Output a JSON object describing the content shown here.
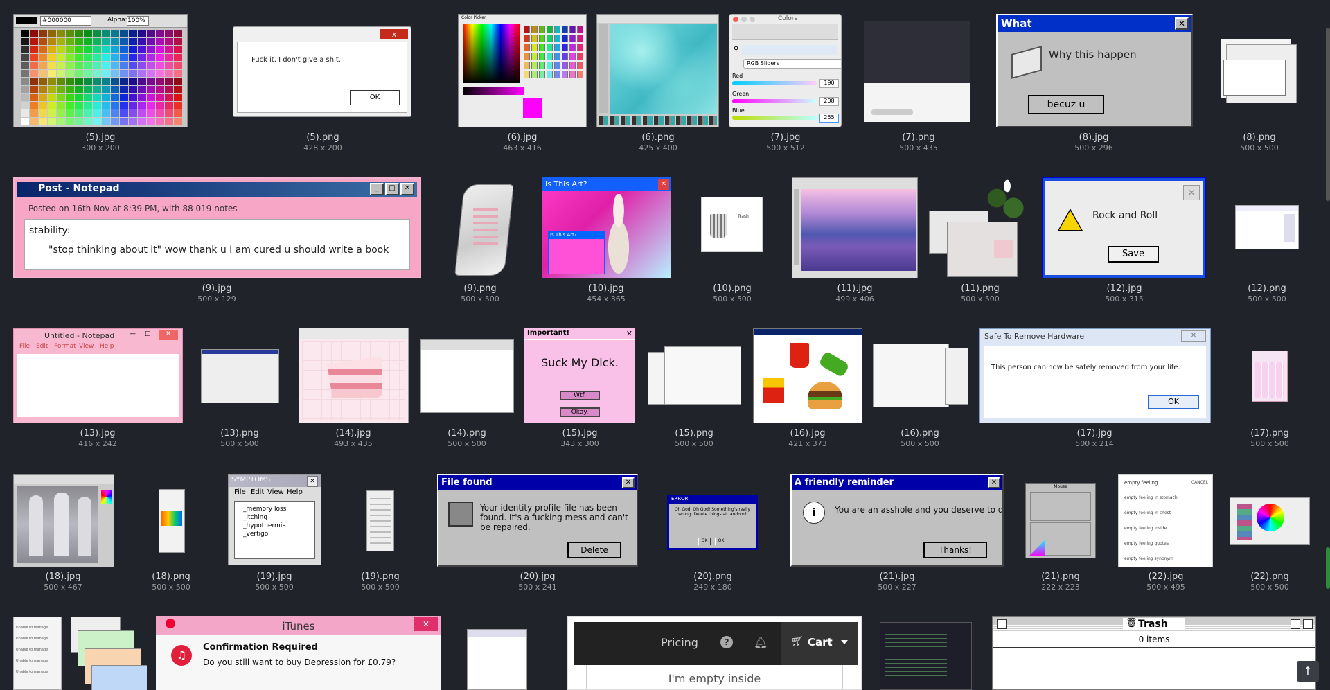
{
  "items": [
    {
      "name": "(5).jpg",
      "size": "300 x 200"
    },
    {
      "name": "(5).png",
      "size": "428 x 200"
    },
    {
      "name": "(6).jpg",
      "size": "463 x 416"
    },
    {
      "name": "(6).png",
      "size": "425 x 400"
    },
    {
      "name": "(7).jpg",
      "size": "500 x 512"
    },
    {
      "name": "(7).png",
      "size": "500 x 435"
    },
    {
      "name": "(8).jpg",
      "size": "500 x 296"
    },
    {
      "name": "(8).png",
      "size": "500 x 500"
    },
    {
      "name": "(9).jpg",
      "size": "500 x 129"
    },
    {
      "name": "(9).png",
      "size": "500 x 500"
    },
    {
      "name": "(10).jpg",
      "size": "454 x 365"
    },
    {
      "name": "(10).png",
      "size": "500 x 500"
    },
    {
      "name": "(11).jpg",
      "size": "499 x 406"
    },
    {
      "name": "(11).png",
      "size": "500 x 500"
    },
    {
      "name": "(12).jpg",
      "size": "500 x 315"
    },
    {
      "name": "(12).png",
      "size": "500 x 500"
    },
    {
      "name": "(13).jpg",
      "size": "416 x 242"
    },
    {
      "name": "(13).png",
      "size": "500 x 500"
    },
    {
      "name": "(14).jpg",
      "size": "493 x 435"
    },
    {
      "name": "(14).png",
      "size": "500 x 500"
    },
    {
      "name": "(15).jpg",
      "size": "343 x 300"
    },
    {
      "name": "(15).png",
      "size": "500 x 500"
    },
    {
      "name": "(16).jpg",
      "size": "421 x 373"
    },
    {
      "name": "(16).png",
      "size": "500 x 500"
    },
    {
      "name": "(17).jpg",
      "size": "500 x 214"
    },
    {
      "name": "(17).png",
      "size": "500 x 500"
    },
    {
      "name": "(18).jpg",
      "size": "500 x 467"
    },
    {
      "name": "(18).png",
      "size": "500 x 500"
    },
    {
      "name": "(19).jpg",
      "size": "500 x 500"
    },
    {
      "name": "(19).png",
      "size": "500 x 500"
    },
    {
      "name": "(20).jpg",
      "size": "500 x 241"
    },
    {
      "name": "(20).png",
      "size": "249 x 180"
    },
    {
      "name": "(21).jpg",
      "size": "500 x 227"
    },
    {
      "name": "(21).png",
      "size": "222 x 223"
    },
    {
      "name": "(22).jpg",
      "size": "500 x 495"
    },
    {
      "name": "(22).png",
      "size": "500 x 500"
    }
  ],
  "thumbs": {
    "t5jpg": {
      "hex": "#000000",
      "alpha_label": "Alpha:",
      "alpha_value": "100%"
    },
    "t5png": {
      "message": "Fuck it. I don't give a shit.",
      "ok": "OK"
    },
    "t6jpg": {
      "title": "Color Picker"
    },
    "t7jpg": {
      "title": "Colors",
      "mode": "RGB Sliders",
      "red_label": "Red",
      "red_value": "190",
      "green_label": "Green",
      "green_value": "208",
      "blue_label": "Blue",
      "blue_value": "255"
    },
    "t8jpg": {
      "title": "What",
      "message": "Why this happen",
      "button": "becuz u"
    },
    "t9jpg": {
      "title": "Post - Notepad",
      "posted": "Posted on 16th Nov at 8:39 PM, with 88 019 notes",
      "line1": "stability:",
      "line2": "\"stop thinking about it\" wow thank u I am cured u should write a book"
    },
    "t10jpg": {
      "title": "Is This Art?",
      "inner_title": "Is This Art?"
    },
    "t10png": {
      "title": "Trash"
    },
    "t12jpg": {
      "message": "Rock and Roll",
      "button": "Save"
    },
    "t13jpg": {
      "title": "Untitled - Notepad",
      "menu": [
        "File",
        "Edit",
        "Format",
        "View",
        "Help"
      ]
    },
    "t15jpg": {
      "title": "Important!",
      "message": "Suck My Dick.",
      "btn1": "Wtf.",
      "btn2": "Okay."
    },
    "t17jpg": {
      "title": "Safe To Remove Hardware",
      "message": "This person can now be safely removed from your life.",
      "ok": "OK"
    },
    "t19jpg": {
      "title": "SYMPTOMS",
      "menu": [
        "File",
        "Edit",
        "View",
        "Help"
      ],
      "lines": [
        "_memory loss",
        "_itching",
        "_hypothermia",
        "_vertigo"
      ]
    },
    "t20jpg": {
      "title": "File found",
      "message": "Your identity profile file has been found. It's a fucking mess and can't be repaired.",
      "button": "Delete"
    },
    "t20png": {
      "title": "ERROR",
      "message": "Oh God. Oh God! Something's really wrong. Delete things at random?",
      "ok1": "OK",
      "ok2": "OK"
    },
    "t21jpg": {
      "title": "A friendly reminder",
      "message": "You are an asshole and you deserve to die.",
      "button": "Thanks!"
    },
    "t21png": {
      "title": "Mouse"
    },
    "t22jpg": {
      "search": "empty feeling",
      "cancel": "CANCEL",
      "suggestions": [
        "empty feeling in stomach",
        "empty feeling in chest",
        "empty feeling inside",
        "empty feeling quotes",
        "empty feeling synonym"
      ]
    },
    "itunes": {
      "title": "iTunes",
      "heading": "Confirmation Required",
      "message": "Do you still want to buy Depression for £0.79?"
    },
    "cart": {
      "pricing": "Pricing",
      "help": "?",
      "cart": "Cart",
      "empty": "I'm empty inside"
    },
    "trash": {
      "title": "Trash",
      "items": "0 items"
    },
    "misc": {
      "unable": "Unable to manage"
    }
  },
  "ui": {
    "scroll_top": "↑"
  },
  "colors": {
    "background": "#20232a",
    "win95_gray": "#c0c0c0",
    "win95_blue": "#0000a8",
    "pink": "#f5b8d4"
  }
}
